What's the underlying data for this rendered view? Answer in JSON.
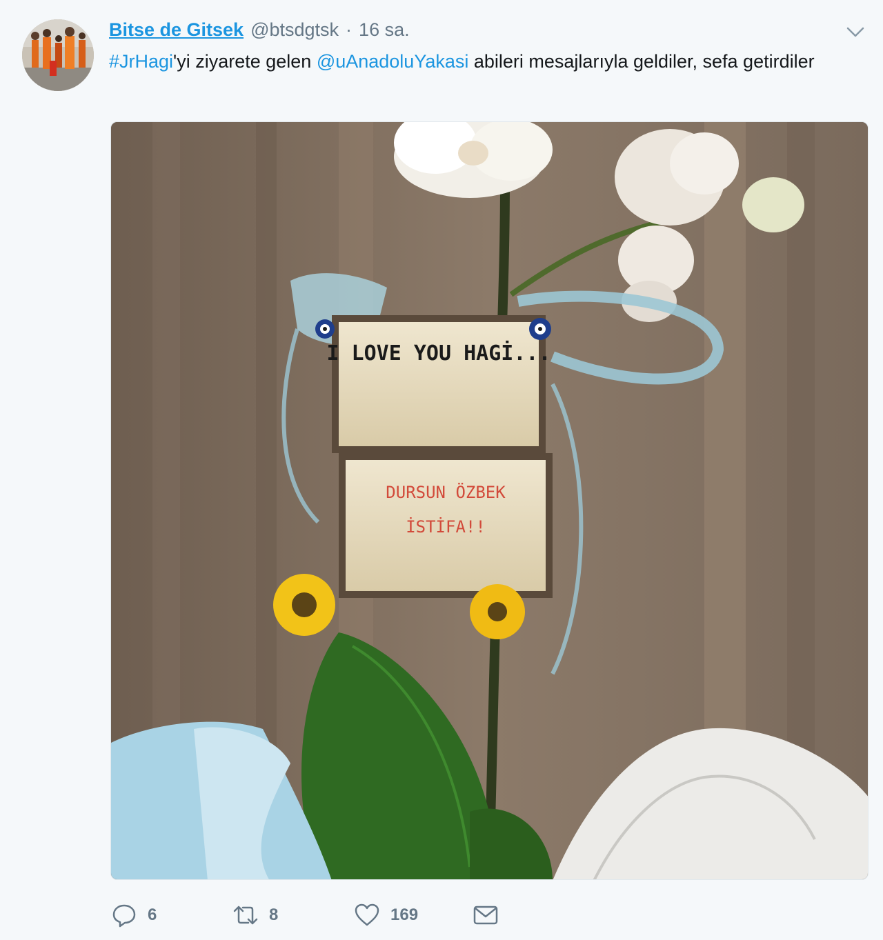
{
  "tweet": {
    "display_name": "Bitse de Gitsek",
    "handle": "@btsdgtsk",
    "separator": "·",
    "time": "16 sa.",
    "text": {
      "hashtag": "#JrHagi",
      "part1": "'yi ziyarete gelen ",
      "mention": "@uAnadoluYakasi",
      "part2": " abileri mesajlarıyla geldiler, sefa getirdiler"
    },
    "media": {
      "note_top": "I LOVE YOU HAGİ...",
      "note_bottom_line1": "DURSUN ÖZBEK",
      "note_bottom_line2": "İSTİFA!!"
    },
    "actions": {
      "reply_count": "6",
      "retweet_count": "8",
      "like_count": "169"
    },
    "icons": {
      "caret": "chevron-down-icon",
      "reply": "reply-icon",
      "retweet": "retweet-icon",
      "like": "heart-icon",
      "dm": "envelope-icon"
    },
    "colors": {
      "link": "#1b95e0",
      "muted": "#657786",
      "background": "#f5f8fa"
    }
  }
}
